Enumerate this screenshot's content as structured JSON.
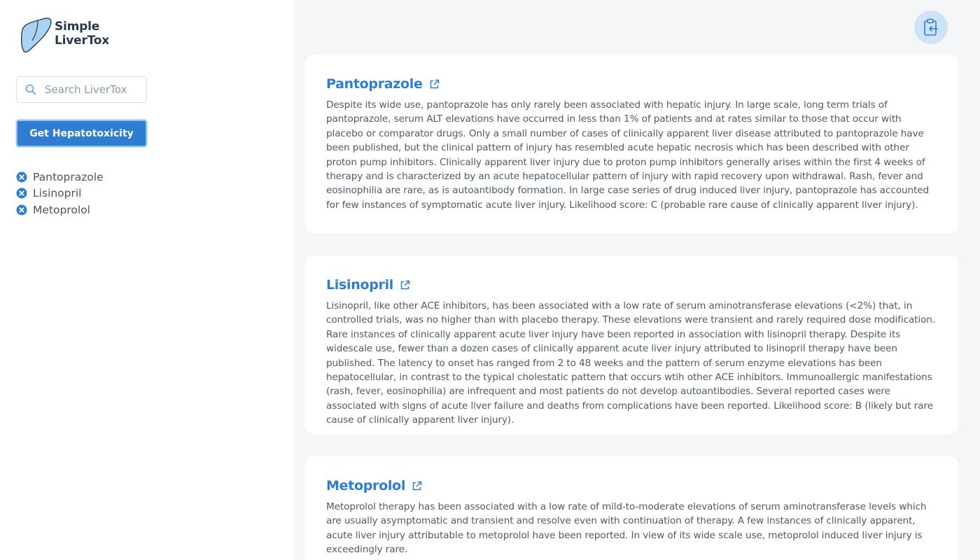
{
  "app": {
    "logo_line1": "Simple",
    "logo_line2": "LiverTox"
  },
  "search": {
    "placeholder": "Search LiverTox",
    "value": ""
  },
  "actions": {
    "get_label": "Get Hepatotoxicity"
  },
  "selected_drugs": [
    {
      "name": "Pantoprazole"
    },
    {
      "name": "Lisinopril"
    },
    {
      "name": "Metoprolol"
    }
  ],
  "results": [
    {
      "title": "Pantoprazole",
      "body": "Despite its wide use, pantoprazole has only rarely been associated with hepatic injury. In large scale, long term trials of pantoprazole, serum ALT elevations have occurred in less than 1% of patients and at rates similar to those that occur with placebo or comparator drugs. Only a small number of cases of clinically apparent liver disease attributed to pantoprazole have been published, but the clinical pattern of injury has resembled acute hepatic necrosis which has been described with other proton pump inhibitors. Clinically apparent liver injury due to proton pump inhibitors generally arises within the first 4 weeks of therapy and is characterized by an acute hepatocellular pattern of injury with rapid recovery upon withdrawal. Rash, fever and eosinophilia are rare, as is autoantibody formation. In large case series of drug induced liver injury, pantoprazole has accounted for few instances of symptomatic acute liver injury. Likelihood score: C (probable rare cause of clinically apparent liver injury)."
    },
    {
      "title": "Lisinopril",
      "body": "Lisinopril, like other ACE inhibitors, has been associated with a low rate of serum aminotransferase elevations (<2%) that, in controlled trials, was no higher than with placebo therapy. These elevations were transient and rarely required dose modification. Rare instances of clinically apparent acute liver injury have been reported in association with lisinopril therapy. Despite its widescale use, fewer than a dozen cases of clinically apparent acute liver injury attributed to lisinopril therapy have been published. The latency to onset has ranged from 2 to 48 weeks and the pattern of serum enzyme elevations has been hepatocellular, in contrast to the typical cholestatic pattern that occurs wtih other ACE inhibitors. Immunoallergic manifestations (rash, fever, eosinophilia) are infrequent and most patients do not develop autoantibodies. Several reported cases were associated with signs of acute liver failure and deaths from complications have been reported. Likelihood score: B (likely but rare cause of clinically apparent liver injury)."
    },
    {
      "title": "Metoprolol",
      "body": "Metoprolol therapy has been associated with a low rate of mild-to-moderate elevations of serum aminotransferase levels which are usually asymptomatic and transient and resolve even with continuation of therapy. A few instances of clinically apparent, acute liver injury attributable to metoprolol have been reported. In view of its wide scale use, metoprolol induced liver injury is exceedingly rare."
    }
  ],
  "icons": {
    "logo": "liver-icon",
    "search": "search-icon",
    "remove": "close-circle-icon",
    "external": "external-link-icon",
    "copy": "clipboard-icon"
  },
  "colors": {
    "accent": "#2f7dd3",
    "background": "#f5f6f8",
    "card": "#ffffff",
    "copy_button": "#cde4f8"
  }
}
